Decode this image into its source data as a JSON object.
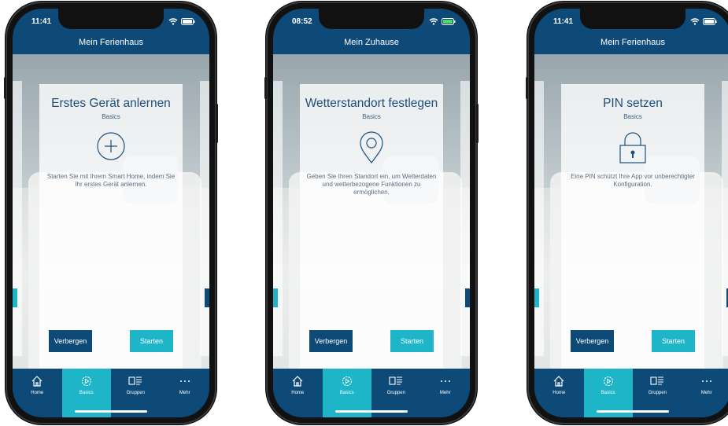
{
  "screens": [
    {
      "time": "11:41",
      "title": "Mein Ferienhaus",
      "card_title": "Erstes Gerät anlernen",
      "card_subtitle": "Basics",
      "card_icon": "plus-circle-icon",
      "card_text": "Starten Sie mit Ihrem Smart Home, indem Sie Ihr erstes Gerät anlernen.",
      "hide_label": "Verbergen",
      "start_label": "Starten"
    },
    {
      "time": "08:52",
      "title": "Mein Zuhause",
      "card_title": "Wetterstandort festlegen",
      "card_subtitle": "Basics",
      "card_icon": "location-pin-icon",
      "card_text": "Geben Sie Ihren Standort ein, um Wetterdaten und wetterbezogene Funktionen zu ermöglichen.",
      "hide_label": "Verbergen",
      "start_label": "Starten"
    },
    {
      "time": "11:41",
      "title": "Mein Ferienhaus",
      "card_title": "PIN setzen",
      "card_subtitle": "Basics",
      "card_icon": "padlock-icon",
      "card_text": "Eine PIN schützt Ihre App vor unberechtigter Konfiguration.",
      "hide_label": "Verbergen",
      "start_label": "Starten"
    }
  ],
  "tabs": [
    {
      "label": "Home",
      "icon": "house-icon"
    },
    {
      "label": "Basics",
      "icon": "basics-gear-icon",
      "active": true
    },
    {
      "label": "Gruppen",
      "icon": "groups-icon"
    },
    {
      "label": "Mehr",
      "icon": "more-dots-icon"
    }
  ],
  "colors": {
    "primary": "#0d4a78",
    "accent": "#1fb5c8",
    "card_title": "#1d4f7a",
    "text_muted": "#5b6e7f"
  }
}
